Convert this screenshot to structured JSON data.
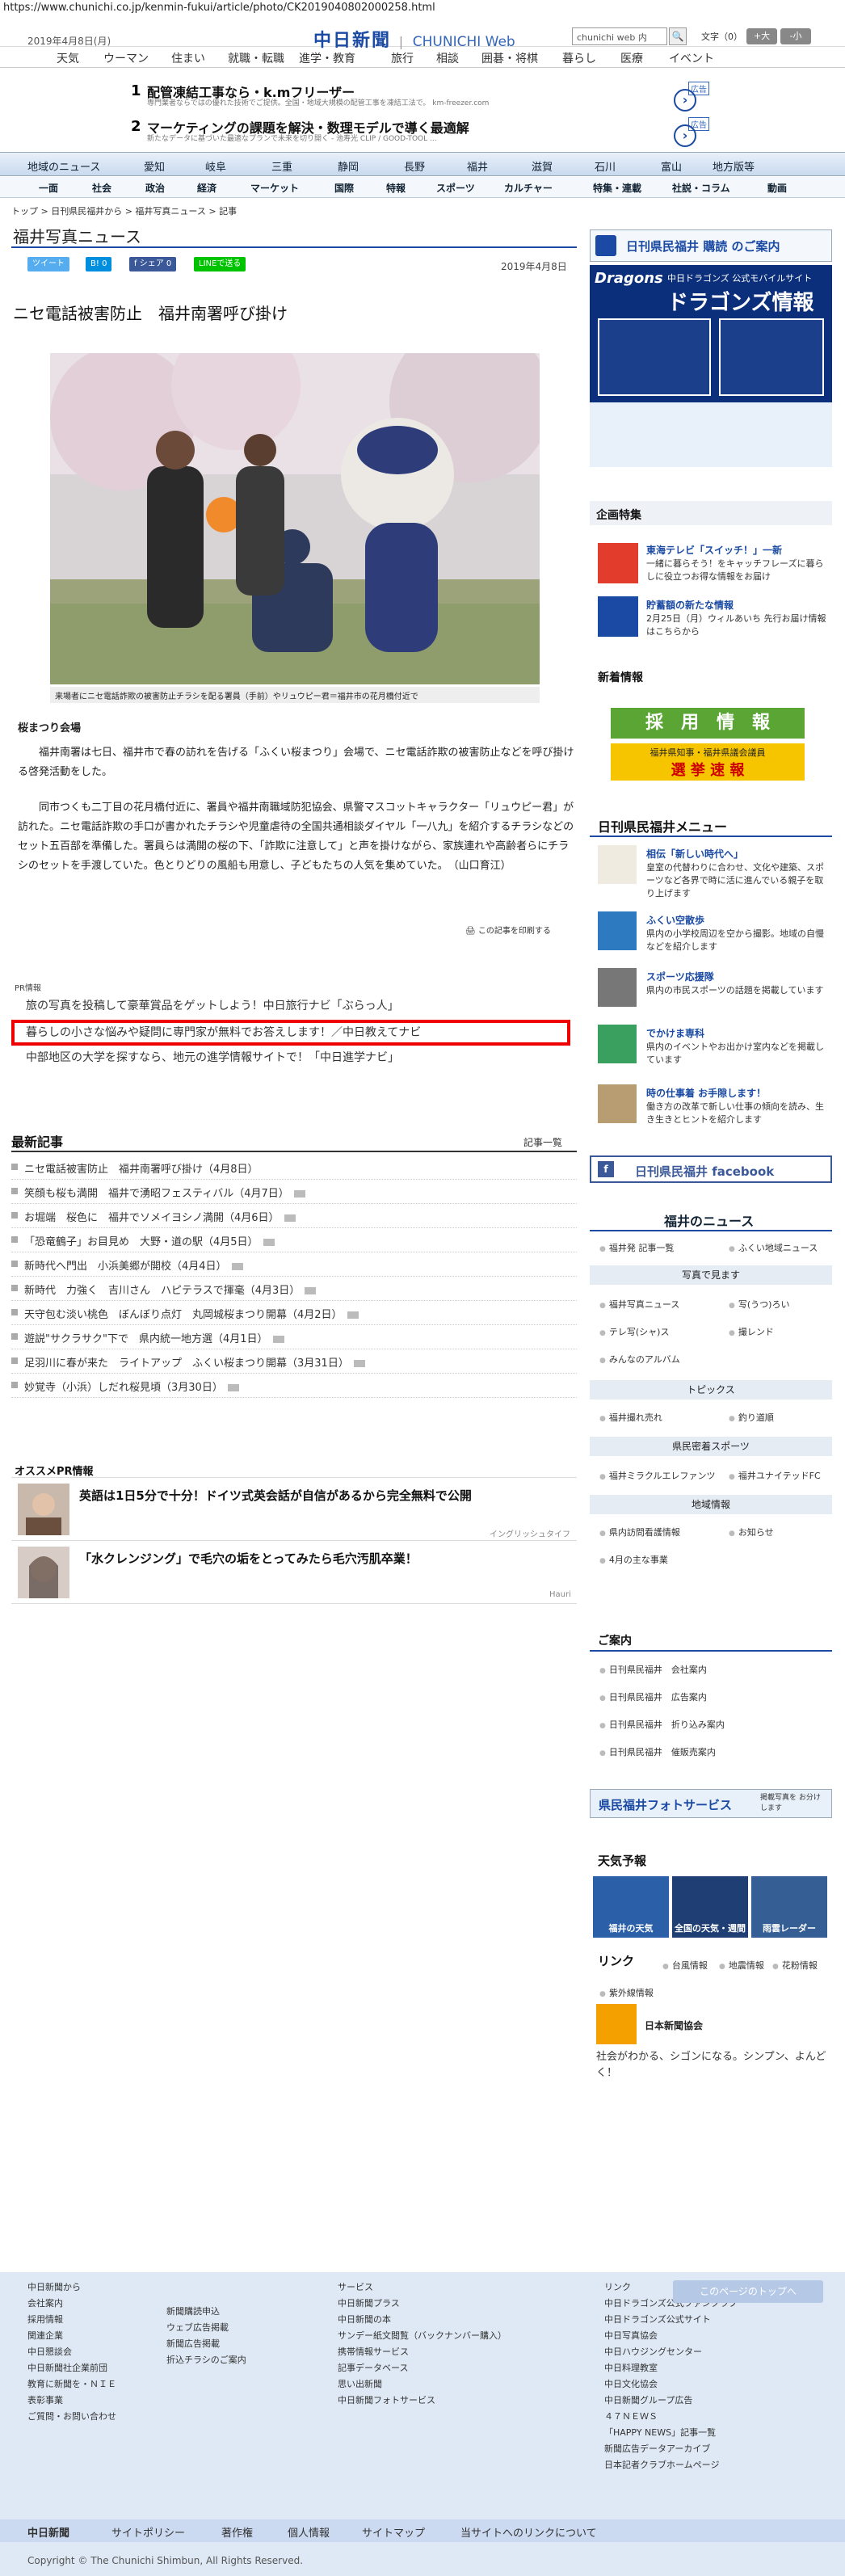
{
  "url": "https://www.chunichi.co.jp/kenmin-fukui/article/photo/CK2019040802000258.html",
  "header": {
    "date": "2019年4月8日(月)",
    "logo": "中日新聞",
    "logo_web": "CHUNICHI Web",
    "search_placeholder": "chunichi web 内",
    "search_btn": "🔍",
    "font_label": "文字（0）",
    "font_big": "+大",
    "font_small": "-小"
  },
  "top_nav": [
    "天気",
    "ウーマン",
    "住まい",
    "就職・転職",
    "進学・教育",
    "旅行",
    "相談",
    "囲碁・将棋",
    "暮らし",
    "医療",
    "イベント"
  ],
  "ads_top": [
    {
      "num": "1",
      "title": "配管凍結工事なら・k.mフリーザー",
      "sub": "専門業者ならではの優れた技術でご提供。全国・地域大規模の配管工事を凍結工法で。 km-freezer.com",
      "tag": "広告"
    },
    {
      "num": "2",
      "title": "マーケティングの課題を解決・数理モデルで導く最適解",
      "sub": "新たなデータに基づいた最適なプランで未来を切り開く - 池寿光 CLIP / GOOD-TOOL ...",
      "tag": "広告"
    }
  ],
  "nav_main": [
    "地域のニュース",
    "愛知",
    "岐阜",
    "三重",
    "静岡",
    "長野",
    "福井",
    "滋賀",
    "石川",
    "富山",
    "地方版等"
  ],
  "nav_sub": [
    "一面",
    "社会",
    "政治",
    "経済",
    "マーケット",
    "国際",
    "特報",
    "スポーツ",
    "カルチャー",
    "特集・連載",
    "社説・コラム",
    "動画"
  ],
  "breadcrumb": "トップ > 日刊県民福井から > 福井写真ニュース > 記事",
  "section_title": "福井写真ニュース",
  "share": {
    "tweet": "ツイート",
    "hatena": "0",
    "fb": "シェア 0",
    "line": "LINEで送る"
  },
  "pub_date": "2019年4月8日",
  "headline": "ニセ電話被害防止　福井南署呼び掛け",
  "caption": "来場者にニセ電話詐欺の被害防止チラシを配る署員（手前）やリュウピー君＝福井市の花月橋付近で",
  "subhead": "桜まつり会場",
  "paragraphs": [
    "福井南署は七日、福井市で春の訪れを告げる「ふくい桜まつり」会場で、ニセ電話詐欺の被害防止などを呼び掛ける啓発活動をした。",
    "同市つくも二丁目の花月橋付近に、署員や福井南職域防犯協会、県警マスコットキャラクター「リュウピー君」が訪れた。ニセ電話詐欺の手口が書かれたチラシや児童虐待の全国共通相談ダイヤル「一八九」を紹介するチラシなどのセット五百部を準備した。署員らは満開の桜の下、「詐欺に注意して」と声を掛けながら、家族連れや高齢者らにチラシのセットを手渡していた。色とりどりの風船も用意し、子どもたちの人気を集めていた。　（山口育江）"
  ],
  "print_link": "この記事を印刷する",
  "pr": {
    "label": "PR情報",
    "items": [
      "旅の写真を投稿して豪華賞品をゲットしよう！中日旅行ナビ「ぶらっ人」",
      "暮らしの小さな悩みや疑問に専門家が無料でお答えします！／中日教えてナビ",
      "中部地区の大学を探すなら、地元の進学情報サイトで！「中日進学ナビ」"
    ]
  },
  "latest": {
    "title": "最新記事",
    "more": "記事一覧",
    "items": [
      "ニセ電話被害防止　福井南署呼び掛け（4月8日）",
      "笑顔も桜も満開　福井で湧昭フェスティバル（4月7日）",
      "お堀端　桜色に　福井でソメイヨシノ満開（4月6日）",
      "「恐竜鶴子」お目見め　大野・道の駅（4月5日）",
      "新時代へ門出　小浜美郷が開校（4月4日）",
      "新時代　力強く　吉川さん　ハピテラスで揮毫（4月3日）",
      "天守包む淡い桃色　ぼんぼり点灯　丸岡城桜まつり開幕（4月2日）",
      "遊説\"サクラサク\"下で　県内統一地方選（4月1日）",
      "足羽川に春が来た　ライトアップ　ふくい桜まつり開幕（3月31日）",
      "妙覚寺（小浜）しだれ桜見頃（3月30日）"
    ]
  },
  "osusume": {
    "title": "オススメPR情報",
    "items": [
      {
        "text": "英語は1日5分で十分！ドイツ式英会話が自信があるから完全無料で公開",
        "source": "イングリッシュタイフ"
      },
      {
        "text": "「水クレンジング」で毛穴の垢をとってみたら毛穴汚肌卒業！",
        "source": "Hauri"
      }
    ]
  },
  "right": {
    "subscribe": "日刊県民福井 購読 のご案内",
    "dragons_a": "中日ドラゴンズ 公式モバイルサイト",
    "dragons_b": "ドラゴンズ情報",
    "kikaku_title": "企画特集",
    "kikaku": [
      {
        "title": "東海テレビ「スイッチ！」一新",
        "desc": "一緒に暮らそう！をキャッチフレーズに暮らしに役立つお得な情報をお届け"
      },
      {
        "title": "貯蓄額の新たな情報",
        "desc": "2月25日（月）ウィルあいち 先行お届け情報はこちらから"
      }
    ],
    "shinchaku": "新着情報",
    "saiyou": "採　用　情　報",
    "senkyo_a": "福井県知事・福井県議会議員",
    "senkyo_b": "選 挙 速 報",
    "menu_title": "日刊県民福井メニュー",
    "menu": [
      {
        "title": "相伝「新しい時代へ」",
        "desc": "皇室の代替わりに合わせ、文化や建築、スポーツなど各界で時に活に進んでいる親子を取り上げます"
      },
      {
        "title": "ふくい空散歩",
        "desc": "県内の小学校周辺を空から撮影。地域の自慢などを紹介します"
      },
      {
        "title": "スポーツ応援隊",
        "desc": "県内の市民スポーツの話題を掲載しています"
      },
      {
        "title": "でかけま専科",
        "desc": "県内のイベントやお出かけ室内などを掲載しています"
      },
      {
        "title": "時の仕事着 お手隙します！",
        "desc": "働き方の改革で新しい仕事の傾向を読み、生き生きとヒントを紹介します"
      }
    ],
    "facebook": "日刊県民福井 facebook",
    "fukui_news_title": "福井のニュース",
    "fukui_news": [
      "福井発 記事一覧",
      "ふくい地域ニュース"
    ],
    "photo_sec": "写真で見ます",
    "photo_links": [
      "福井写真ニュース",
      "写(うつ)ろい",
      "テレ写(シャ)ス",
      "撮レンド",
      "みんなのアルバム"
    ],
    "topics_sec": "トピックス",
    "topics_links": [
      "福井撮れ売れ",
      "釣り道順"
    ],
    "sports_sec": "県民密着スポーツ",
    "sports_links": [
      "福井ミラクルエレファンツ",
      "福井ユナイテッドFC"
    ],
    "chiiki_sec": "地域情報",
    "chiiki_links": [
      "県内訪問看護情報",
      "お知らせ",
      "4月の主な事業"
    ],
    "annai_title": "ご案内",
    "annai_links": [
      "日刊県民福井　会社案内",
      "日刊県民福井　広告案内",
      "日刊県民福井　折り込み案内",
      "日刊県民福井　催販売案内"
    ],
    "photo_service": "県民福井フォトサービス",
    "photo_service_note": "掲載写真を お分けします",
    "weather_title": "天気予報",
    "weather_cards": [
      "福井の天気",
      "全国の天気・週間",
      "雨雲レーダー"
    ],
    "link_title": "リンク",
    "link_items": [
      "台風情報",
      "地震情報",
      "花粉情報",
      "紫外線情報"
    ],
    "nihon_title": "日本新聞協会",
    "nihon_desc": "社会がわかる、シゴンになる。シンプン、よんどく！"
  },
  "footer": {
    "to_top": "このページのトップへ",
    "col1_title": "中日新聞から",
    "col1": [
      "会社案内",
      "採用情報",
      "関連企業",
      "中日懇談会",
      "中日新聞社企業前団",
      "教育に新聞を・ＮＩＥ",
      "表彰事業",
      "ご質問・お問い合わせ"
    ],
    "col2": [
      "新聞購読申込",
      "ウェブ広告掲載",
      "新聞広告掲載",
      "折込チラシのご案内"
    ],
    "col3_title": "サービス",
    "col3": [
      "中日新聞プラス",
      "中日新聞の本",
      "サンデー紙文閲覧（バックナンバー購入）",
      "携帯情報サービス",
      "記事データベース",
      "思い出新聞",
      "中日新聞フォトサービス"
    ],
    "col4_title": "リンク",
    "col4": [
      "中日ドラゴンズ公式ファンクラブ",
      "中日ドラゴンズ公式サイト",
      "中日写真協会",
      "中日ハウジングセンター",
      "中日料理教室",
      "中日文化協会",
      "中日新聞グループ広告",
      "４７ＮＥＷＳ",
      "「HAPPY NEWS」記事一覧",
      "新聞広告データアーカイブ",
      "日本記者クラブホームページ"
    ],
    "bottom": [
      "中日新聞",
      "サイトポリシー",
      "著作権",
      "個人情報",
      "サイトマップ",
      "当サイトへのリンクについて"
    ],
    "copyright": "Copyright © The Chunichi Shimbun, All Rights Reserved."
  }
}
